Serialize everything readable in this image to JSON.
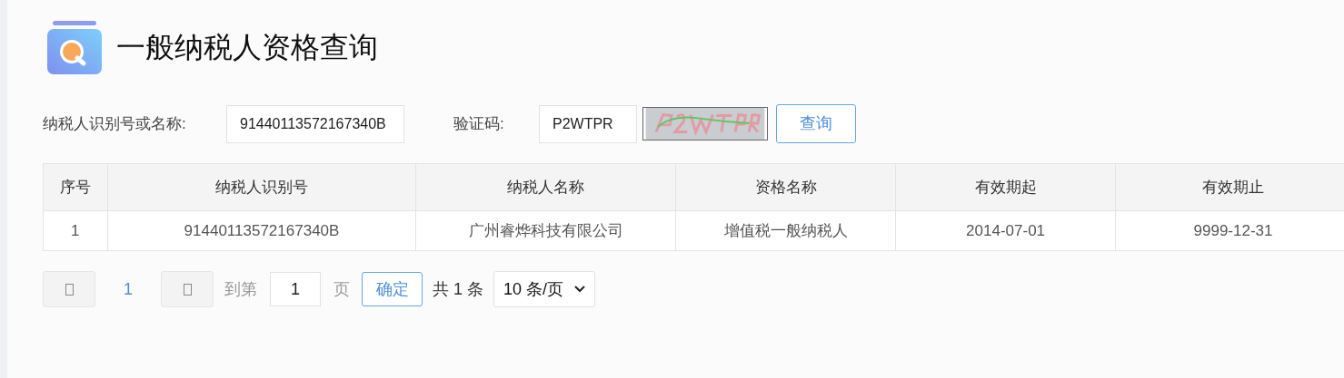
{
  "page": {
    "title": "一般纳税人资格查询"
  },
  "form": {
    "fields": [
      {
        "label": "纳税人识别号或名称:",
        "value": "91440113572167340B",
        "kind": "text"
      },
      {
        "label": "验证码:",
        "value": "P2WTPR",
        "kind": "captcha"
      }
    ],
    "button": "查询"
  },
  "table": {
    "columns": [
      "序号",
      "纳税人识别号",
      "纳税人名称",
      "资格名称",
      "有效期起",
      "有效期止"
    ],
    "rows": [
      [
        "1",
        "91440113572167340B",
        "广州睿烨科技有限公司",
        "增值税一般纳税人",
        "2014-07-01",
        "9999-12-31"
      ]
    ]
  },
  "pagination": {
    "pages": [
      {
        "label": "1",
        "selected": true
      }
    ],
    "goto_label": "到第",
    "goto_value": "1",
    "page_unit": "页",
    "confirm": "确定",
    "total": "共 1 条",
    "page_size": "10 条/页"
  }
}
